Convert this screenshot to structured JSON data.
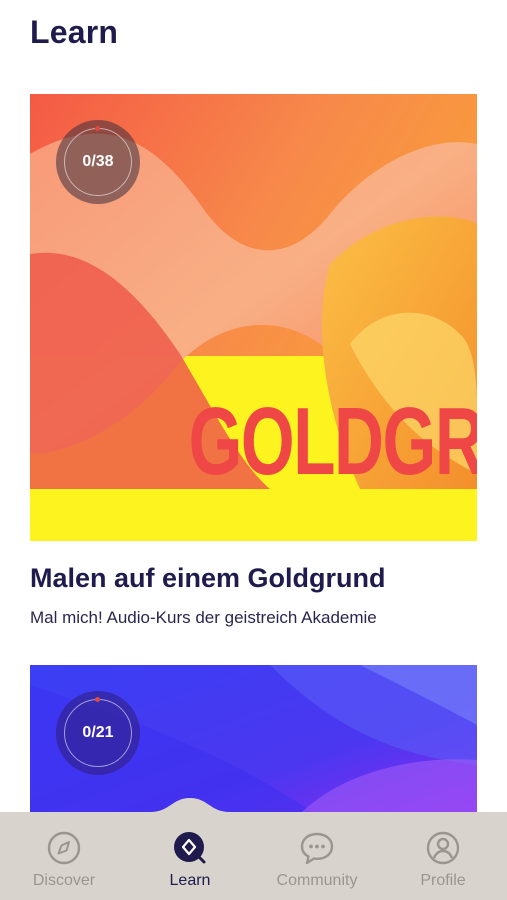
{
  "page": {
    "title": "Learn"
  },
  "courses": [
    {
      "progress": "0/38",
      "cover_text": "GOLDGR",
      "title": "Malen auf einem Goldgrund",
      "subtitle": "Mal mich! Audio-Kurs der geistreich Akademie",
      "colors": {
        "accent": "#ef4646",
        "yellow": "#fdf31f",
        "orange": "#f9a436"
      }
    },
    {
      "progress": "0/21",
      "colors": {
        "blue": "#3e3cf2",
        "purple": "#8b2cf0"
      }
    }
  ],
  "tabbar": {
    "items": [
      {
        "label": "Discover",
        "icon": "compass-icon",
        "active": false
      },
      {
        "label": "Learn",
        "icon": "learn-icon",
        "active": true
      },
      {
        "label": "Community",
        "icon": "chat-bubble-icon",
        "active": false
      },
      {
        "label": "Profile",
        "icon": "user-icon",
        "active": false
      }
    ]
  }
}
